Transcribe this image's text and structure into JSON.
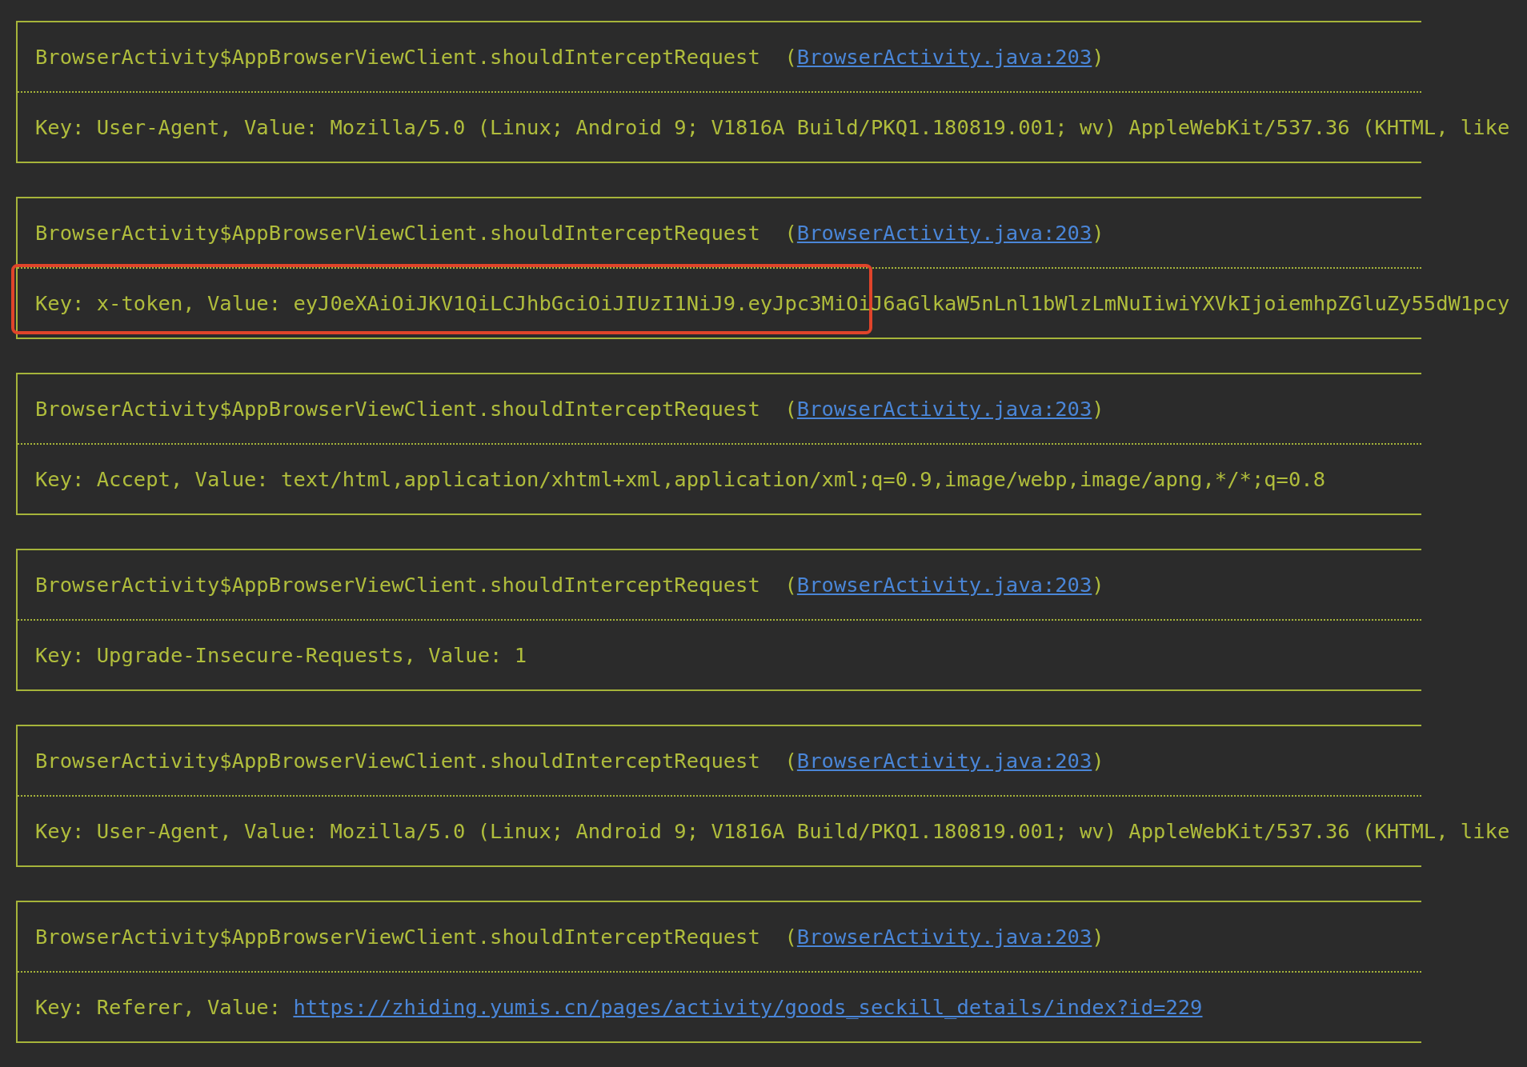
{
  "log_entries": [
    {
      "header": {
        "text": "BrowserActivity$AppBrowserViewClient.shouldInterceptRequest  (",
        "link": "BrowserActivity.java:203",
        "after": ")"
      },
      "body": {
        "text": "Key: User-Agent, Value: Mozilla/5.0 (Linux; Android 9; V1816A Build/PKQ1.180819.001; wv) AppleWebKit/537.36 (KHTML, like"
      },
      "highlighted": false
    },
    {
      "header": {
        "text": "BrowserActivity$AppBrowserViewClient.shouldInterceptRequest  (",
        "link": "BrowserActivity.java:203",
        "after": ")"
      },
      "body": {
        "text": "Key: x-token, Value: eyJ0eXAiOiJKV1QiLCJhbGciOiJIUzI1NiJ9.eyJpc3MiOiJ6aGlkaW5nLnl1bWlzLmNuIiwiYXVkIjoiemhpZGluZy55dW1pcy"
      },
      "highlighted": true
    },
    {
      "header": {
        "text": "BrowserActivity$AppBrowserViewClient.shouldInterceptRequest  (",
        "link": "BrowserActivity.java:203",
        "after": ")"
      },
      "body": {
        "text": "Key: Accept, Value: text/html,application/xhtml+xml,application/xml;q=0.9,image/webp,image/apng,*/*;q=0.8"
      },
      "highlighted": false
    },
    {
      "header": {
        "text": "BrowserActivity$AppBrowserViewClient.shouldInterceptRequest  (",
        "link": "BrowserActivity.java:203",
        "after": ")"
      },
      "body": {
        "text": "Key: Upgrade-Insecure-Requests, Value: 1"
      },
      "highlighted": false
    },
    {
      "header": {
        "text": "BrowserActivity$AppBrowserViewClient.shouldInterceptRequest  (",
        "link": "BrowserActivity.java:203",
        "after": ")"
      },
      "body": {
        "text": "Key: User-Agent, Value: Mozilla/5.0 (Linux; Android 9; V1816A Build/PKQ1.180819.001; wv) AppleWebKit/537.36 (KHTML, like"
      },
      "highlighted": false
    },
    {
      "header": {
        "text": "BrowserActivity$AppBrowserViewClient.shouldInterceptRequest  (",
        "link": "BrowserActivity.java:203",
        "after": ")"
      },
      "body": {
        "text": "Key: Referer, Value: ",
        "link": "https://zhiding.yumis.cn/pages/activity/goods_seckill_details/index?id=229"
      },
      "highlighted": false
    }
  ]
}
